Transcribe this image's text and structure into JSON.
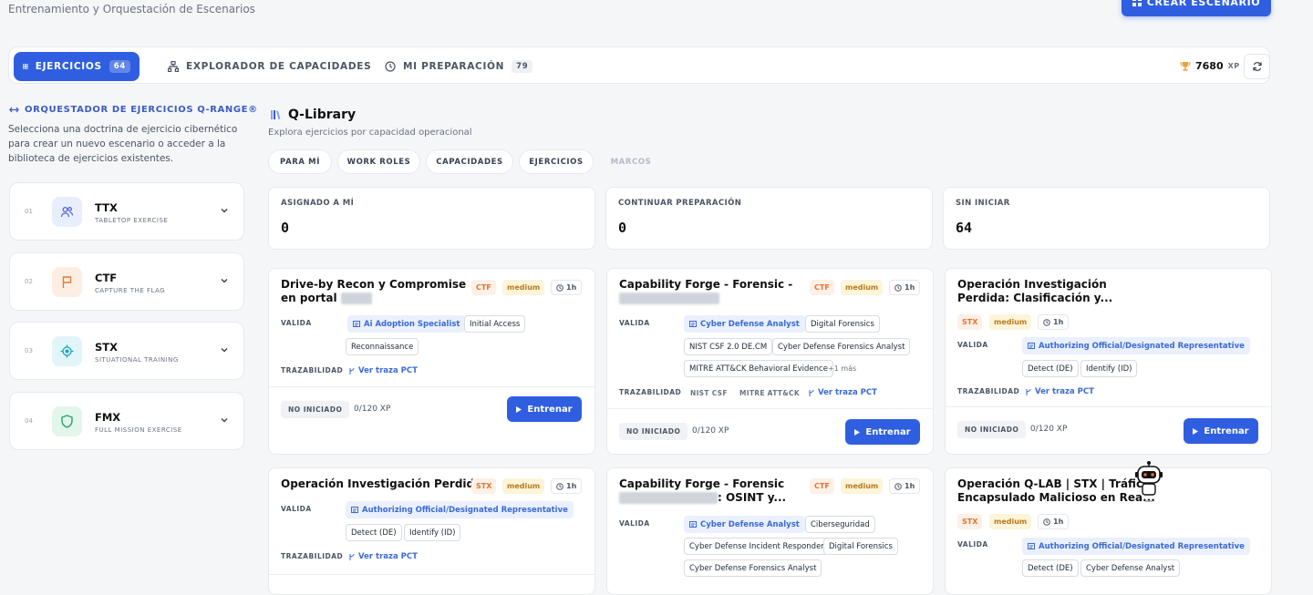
{
  "header": {
    "subtitle": "Entrenamiento y Orquestación de Escenarios",
    "create_button": "CREAR ESCENARIO"
  },
  "tabs": [
    {
      "label": "EJERCICIOS",
      "count": "64",
      "icon": "grid-icon"
    },
    {
      "label": "EXPLORADOR DE CAPACIDADES",
      "icon": "hierarchy-icon"
    },
    {
      "label": "MI PREPARACIÓN",
      "count": "79",
      "icon": "clock-icon"
    }
  ],
  "xp": {
    "value": "7680",
    "unit": "XP"
  },
  "sidebar": {
    "title": "ORQUESTADOR DE EJERCICIOS Q-RANGE®",
    "description": "Selecciona una doctrina de ejercicio cibernético para crear un nuevo escenario o acceder a la biblioteca de ejercicios existentes.",
    "doctrines": [
      {
        "num": "01",
        "name": "TTX",
        "sub": "TABLETOP EXERCISE",
        "icon": "users-icon",
        "color": "#4f6bd6",
        "bg": "#e9eefc"
      },
      {
        "num": "02",
        "name": "CTF",
        "sub": "CAPTURE THE FLAG",
        "icon": "flag-icon",
        "color": "#e07a3b",
        "bg": "#fdeee4"
      },
      {
        "num": "03",
        "name": "STX",
        "sub": "SITUATIONAL TRAINING",
        "icon": "target-icon",
        "color": "#1aa3b8",
        "bg": "#e2f5f8"
      },
      {
        "num": "04",
        "name": "FMX",
        "sub": "FULL MISSION EXERCISE",
        "icon": "shield-icon",
        "color": "#2fa36b",
        "bg": "#e3f6ec"
      }
    ]
  },
  "library": {
    "title": "Q-Library",
    "subtitle": "Explora ejercicios por capacidad operacional",
    "filters": [
      "PARA MÍ",
      "WORK ROLES",
      "CAPACIDADES",
      "EJERCICIOS",
      "MARCOS"
    ],
    "stats": [
      {
        "label": "ASIGNADO A MÍ",
        "value": "0"
      },
      {
        "label": "CONTINUAR PREPARACIÓN",
        "value": "0"
      },
      {
        "label": "SIN INICIAR",
        "value": "64"
      }
    ]
  },
  "labels": {
    "valida": "VALIDA",
    "trazabilidad": "TRAZABILIDAD",
    "trace_link": "Ver traza PCT",
    "status": "NO INICIADO",
    "xp": "0/120 XP",
    "train": "Entrenar",
    "more": "+1 más"
  },
  "cards": [
    {
      "line1": "Drive-by Recon y Compromise",
      "line2": "en portal",
      "type": "CTF",
      "level": "medium",
      "duration": "1h",
      "tags": [
        "Ai Adoption Specialist",
        "Initial Access",
        "Reconnaissance"
      ]
    },
    {
      "line1": "Capability Forge - Forensic -",
      "line2": "",
      "type": "CTF",
      "level": "medium",
      "duration": "1h",
      "tags": [
        "Cyber Defense Analyst",
        "Digital Forensics",
        "NIST CSF 2.0 DE.CM",
        "Cyber Defense Forensics Analyst",
        "MITRE ATT&CK Behavioral Evidence"
      ],
      "frameworks": [
        "NIST CSF",
        "MITRE ATT&CK"
      ]
    },
    {
      "line1": "Operación Investigación",
      "line2": "Perdida: Clasificación y...",
      "type": "STX",
      "level": "medium",
      "duration": "1h",
      "tags": [
        "Authorizing Official/Designated Representative",
        "Detect (DE)",
        "Identify (ID)"
      ]
    },
    {
      "line1": "Operación Investigación Perdida",
      "type": "STX",
      "level": "medium",
      "duration": "1h",
      "tags": [
        "Authorizing Official/Designated Representative",
        "Detect (DE)",
        "Identify (ID)"
      ]
    },
    {
      "line1": "Capability Forge - Forensic",
      "line2": ": OSINT y...",
      "type": "CTF",
      "level": "medium",
      "duration": "1h",
      "tags": [
        "Cyber Defense Analyst",
        "Ciberseguridad",
        "Cyber Defense Incident Responder",
        "Digital Forensics",
        "Cyber Defense Forensics Analyst"
      ]
    },
    {
      "line1": "Operación Q-LAB | STX | Tráfico",
      "line2": "Encapsulado Malicioso en Rea...",
      "type": "STX",
      "level": "medium",
      "duration": "1h",
      "tags": [
        "Authorizing Official/Designated Representative",
        "Detect (DE)",
        "Cyber Defense Analyst"
      ]
    }
  ]
}
